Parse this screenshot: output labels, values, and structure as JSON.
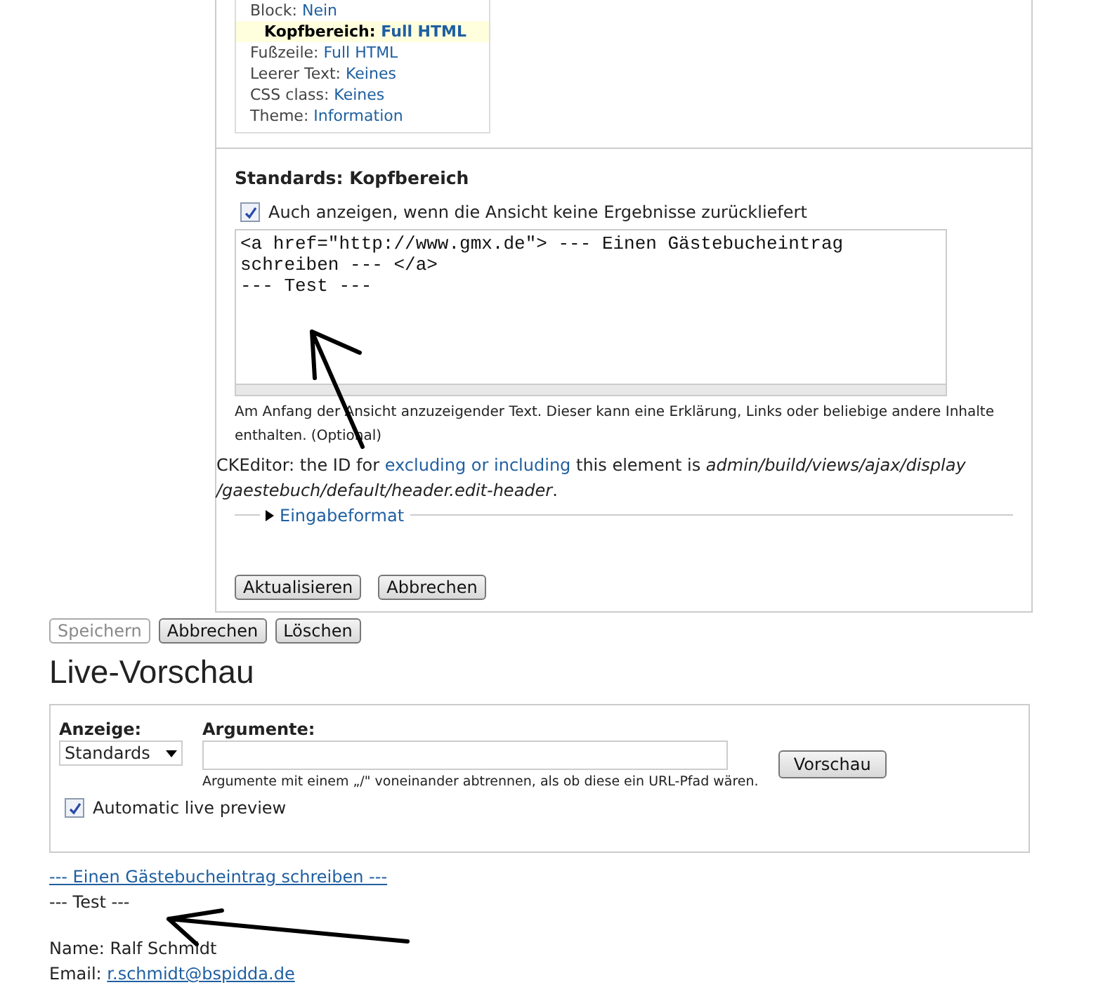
{
  "settings": [
    {
      "label": "Block:",
      "value": "Nein",
      "selected": false
    },
    {
      "label": "Kopfbereich:",
      "value": "Full HTML",
      "selected": true
    },
    {
      "label": "Fußzeile:",
      "value": "Full HTML",
      "selected": false
    },
    {
      "label": "Leerer Text:",
      "value": "Keines",
      "selected": false
    },
    {
      "label": "CSS class:",
      "value": "Keines",
      "selected": false
    },
    {
      "label": "Theme:",
      "value": "Information",
      "selected": false
    }
  ],
  "header_form": {
    "title": "Standards: Kopfbereich",
    "empty_checkbox": {
      "label": "Auch anzeigen, wenn die Ansicht keine Ergebnisse zurückliefert",
      "checked": true
    },
    "textarea": "<a href=\"http://www.gmx.de\"> --- Einen Gästebucheintrag schreiben --- </a>\n--- Test ---",
    "description": "Am Anfang der Ansicht anzuzeigender Text. Dieser kann eine Erklärung, Links oder beliebige andere Inhalte enthalten. (Optional)",
    "ckeditor_note": {
      "prefix": "CKEditor: the ID for",
      "link": "excluding or including",
      "middle": "this element is",
      "path": "admin/build/views/ajax/display /gaestebuch/default/header.edit-header",
      "suffix": "."
    },
    "format_legend": {
      "label": "Eingabeformat",
      "expanded": false
    },
    "buttons": [
      {
        "label": "Aktualisieren"
      },
      {
        "label": "Abbrechen"
      }
    ]
  },
  "main_buttons": [
    {
      "label": "Speichern",
      "disabled": true
    },
    {
      "label": "Abbrechen",
      "disabled": false
    },
    {
      "label": "Löschen",
      "disabled": false
    }
  ],
  "preview": {
    "title": "Live-Vorschau",
    "display_label": "Anzeige:",
    "display_value": "Standards",
    "args_label": "Argumente:",
    "args_hint": "Argumente mit einem „/\" voneinander abtrennen, als ob diese ein URL-Pfad wären.",
    "button": "Vorschau",
    "auto": {
      "label": "Automatic live preview",
      "checked": true
    }
  },
  "output": {
    "link": "--- Einen Gästebucheintrag schreiben ---",
    "test": "--- Test ---",
    "name": "Name: Ralf Schmidt",
    "email_label": "Email:",
    "email": "r.schmidt@bspidda.de"
  }
}
